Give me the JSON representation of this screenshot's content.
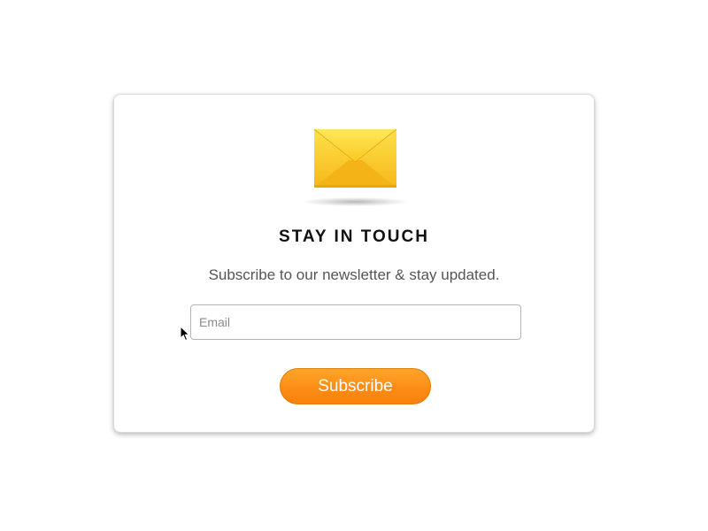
{
  "newsletter": {
    "icon": "envelope-icon",
    "title": "STAY IN TOUCH",
    "subtitle": "Subscribe to our newsletter & stay updated.",
    "email_placeholder": "Email",
    "email_value": "",
    "subscribe_label": "Subscribe"
  },
  "colors": {
    "envelope": "#f9c823",
    "button": "#fb8b14",
    "title": "#111111",
    "subtitle": "#555555"
  },
  "cursor": "arrow-cursor-icon"
}
